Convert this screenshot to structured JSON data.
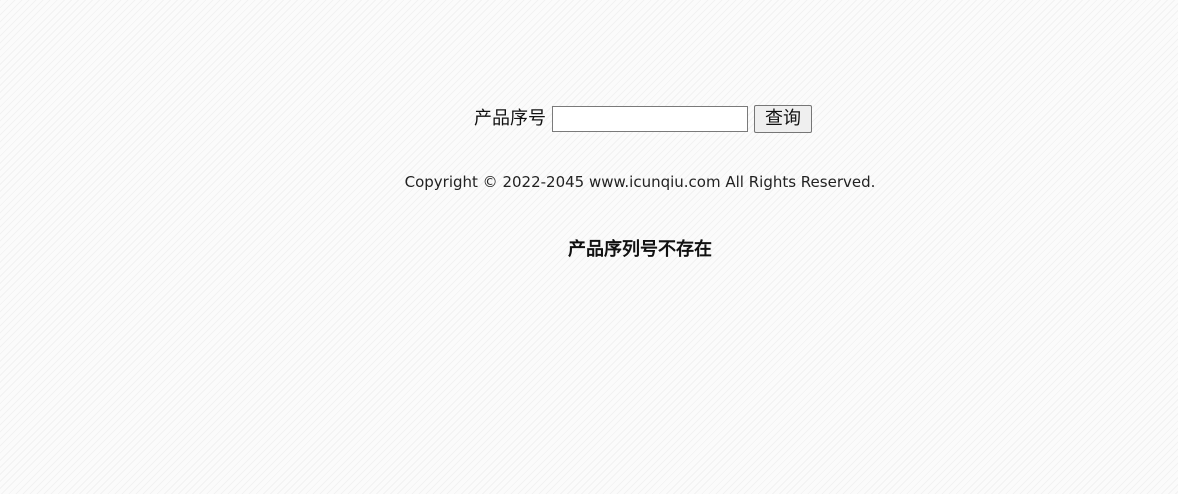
{
  "search": {
    "label": "产品序号",
    "input_value": "",
    "placeholder": "",
    "button_label": "查询"
  },
  "footer": {
    "copyright": "Copyright © 2022-2045 www.icunqiu.com All Rights Reserved."
  },
  "result": {
    "message": "产品序列号不存在"
  }
}
